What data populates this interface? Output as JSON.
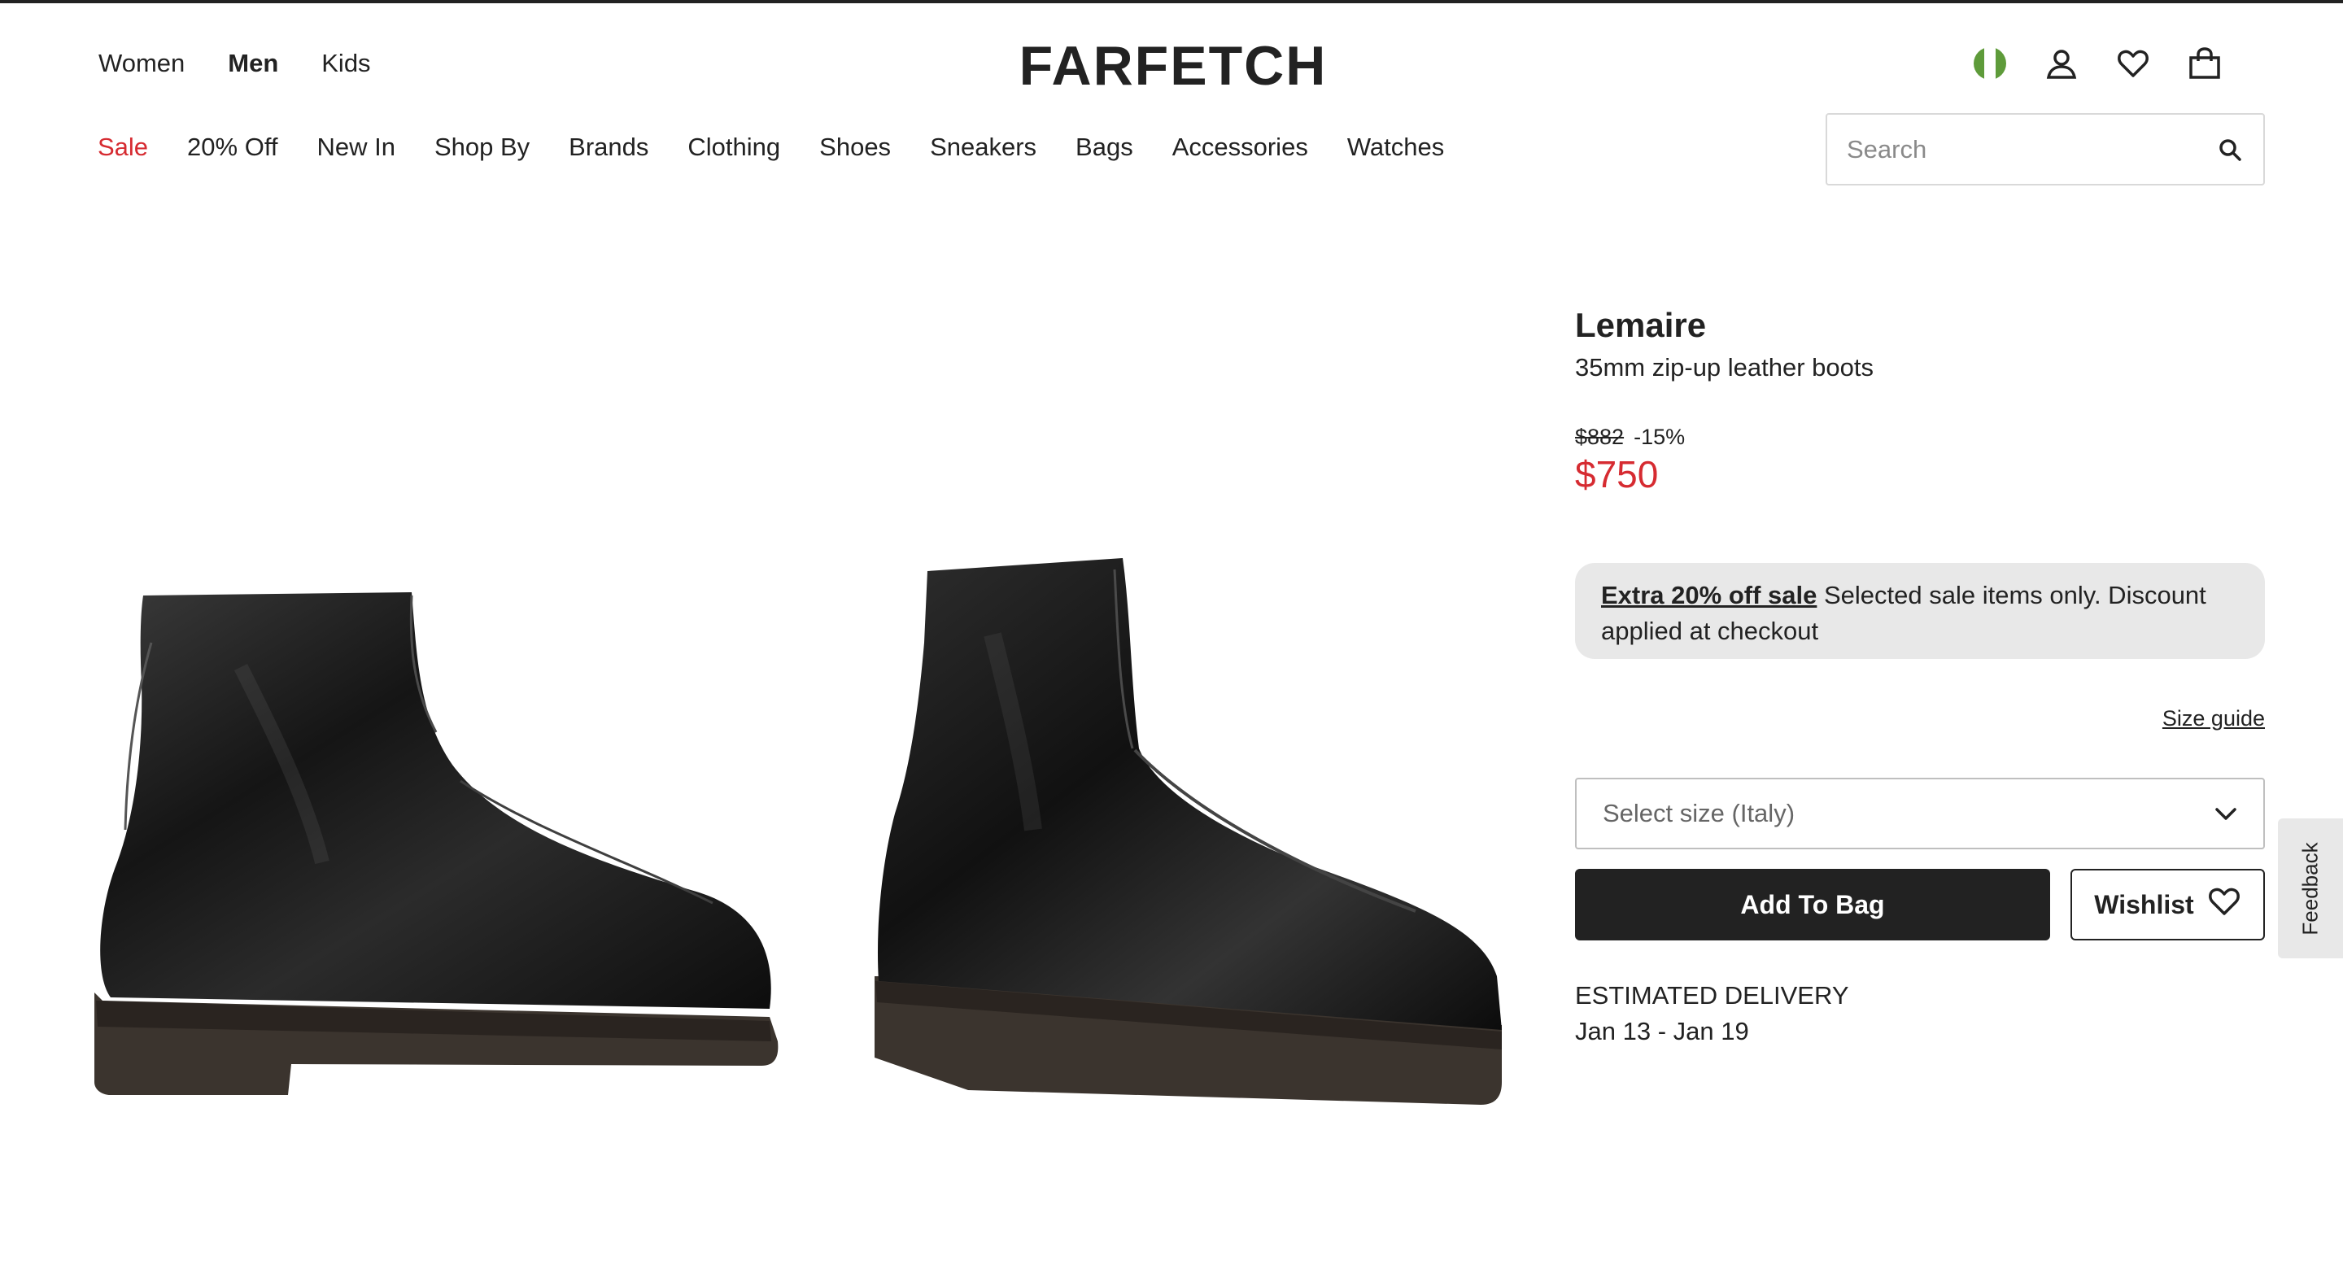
{
  "header": {
    "gender_tabs": [
      "Women",
      "Men",
      "Kids"
    ],
    "active_gender": "Men",
    "logo_text": "FARFETCH",
    "icons": [
      "region-flag-icon",
      "account-icon",
      "wishlist-heart-icon",
      "shopping-bag-icon"
    ]
  },
  "nav": {
    "categories": [
      "Sale",
      "20% Off",
      "New In",
      "Shop By",
      "Brands",
      "Clothing",
      "Shoes",
      "Sneakers",
      "Bags",
      "Accessories",
      "Watches"
    ],
    "sale_color": "#d62b31"
  },
  "search": {
    "placeholder": "Search",
    "value": ""
  },
  "product": {
    "brand": "Lemaire",
    "name": "35mm zip-up leather boots",
    "original_price": "$882",
    "discount": "-15%",
    "sale_price": "$750",
    "promo_link": "Extra 20% off sale",
    "promo_text": " Selected sale items only. Discount applied at checkout",
    "size_guide": "Size guide",
    "size_select_placeholder": "Select size (Italy)",
    "add_to_bag": "Add To Bag",
    "wishlist": "Wishlist",
    "delivery_label": "ESTIMATED DELIVERY",
    "delivery_dates": "Jan 13 - Jan 19"
  },
  "feedback_label": "Feedback",
  "colors": {
    "accent_red": "#d62b31",
    "primary_dark": "#222222",
    "promo_bg": "#e8e8e8"
  }
}
